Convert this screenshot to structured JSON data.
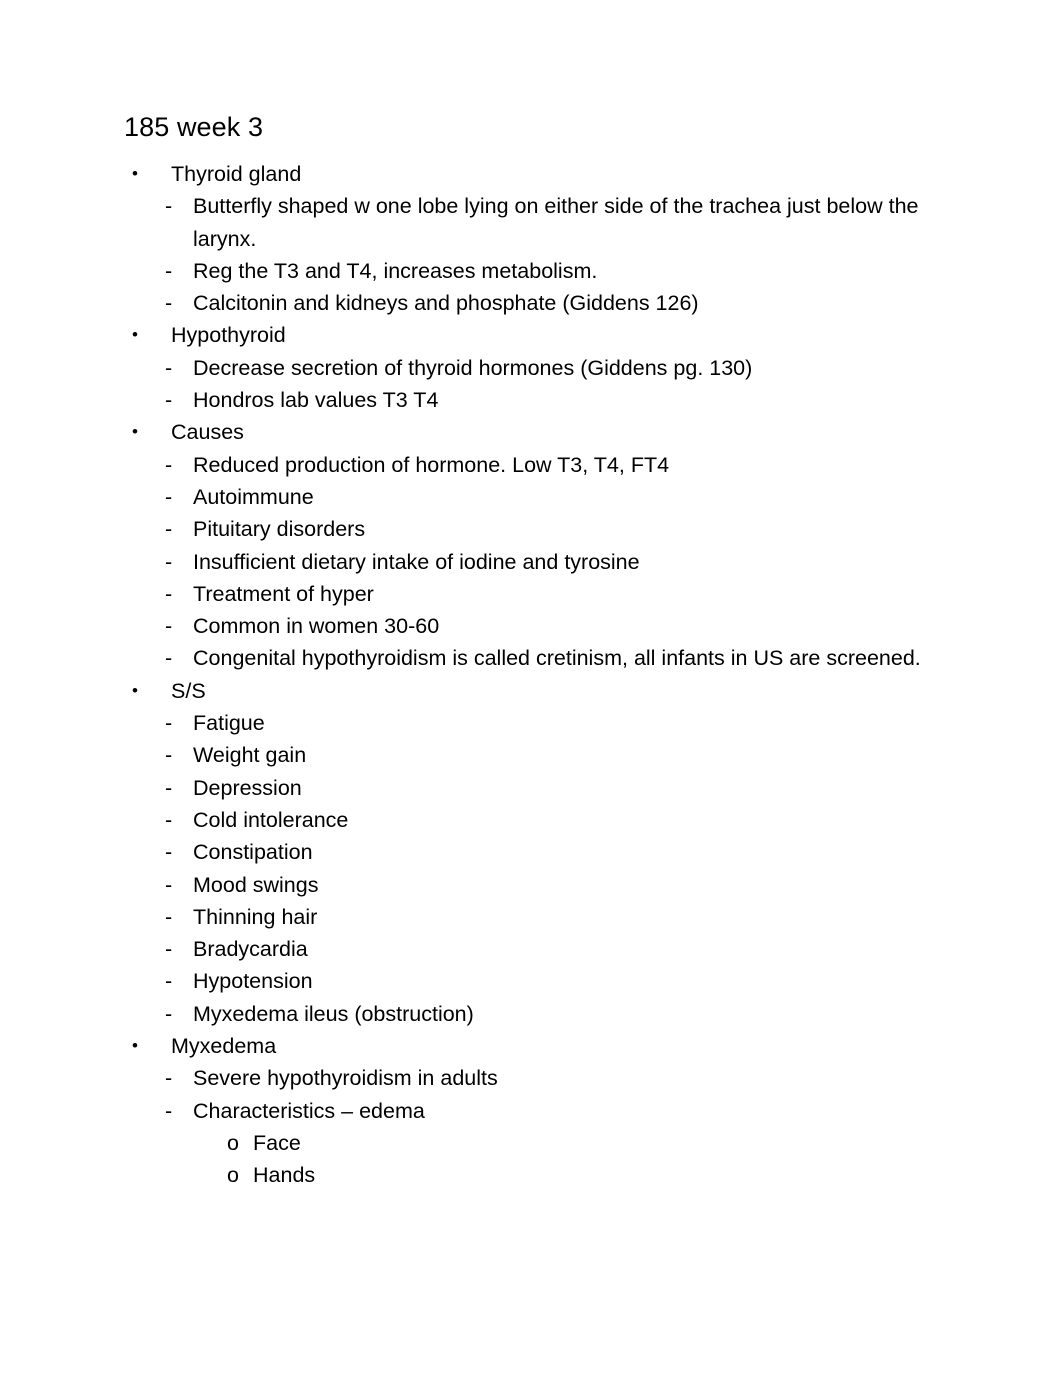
{
  "document": {
    "title": "185 week 3",
    "background_color": "#ffffff",
    "text_color": "#000000",
    "markers": {
      "level1": "•",
      "level2": "-",
      "level3": "o"
    },
    "outline": [
      {
        "level": 1,
        "text": "Thyroid gland"
      },
      {
        "level": 2,
        "text": "Butterfly shaped w one lobe lying on either side of the trachea just below the larynx."
      },
      {
        "level": 2,
        "text": "Reg the T3 and T4, increases metabolism."
      },
      {
        "level": 2,
        "text": "Calcitonin and kidneys and phosphate (Giddens 126)"
      },
      {
        "level": 1,
        "text": "Hypothyroid"
      },
      {
        "level": 2,
        "text": "Decrease secretion of thyroid hormones (Giddens pg. 130)"
      },
      {
        "level": 2,
        "text": "Hondros lab values T3 T4"
      },
      {
        "level": 1,
        "text": "Causes"
      },
      {
        "level": 2,
        "text": "Reduced production of hormone. Low T3, T4, FT4"
      },
      {
        "level": 2,
        "text": "Autoimmune"
      },
      {
        "level": 2,
        "text": "Pituitary disorders"
      },
      {
        "level": 2,
        "text": "Insufficient dietary intake of iodine and tyrosine"
      },
      {
        "level": 2,
        "text": "Treatment of hyper"
      },
      {
        "level": 2,
        "text": "Common in women 30-60"
      },
      {
        "level": 2,
        "text": "Congenital hypothyroidism is called cretinism, all infants in US are screened."
      },
      {
        "level": 1,
        "text": "S/S"
      },
      {
        "level": 2,
        "text": "Fatigue"
      },
      {
        "level": 2,
        "text": "Weight gain"
      },
      {
        "level": 2,
        "text": "Depression"
      },
      {
        "level": 2,
        "text": "Cold intolerance"
      },
      {
        "level": 2,
        "text": "Constipation"
      },
      {
        "level": 2,
        "text": "Mood swings"
      },
      {
        "level": 2,
        "text": "Thinning hair"
      },
      {
        "level": 2,
        "text": "Bradycardia"
      },
      {
        "level": 2,
        "text": "Hypotension"
      },
      {
        "level": 2,
        "text": "Myxedema ileus (obstruction)"
      },
      {
        "level": 1,
        "text": "Myxedema"
      },
      {
        "level": 2,
        "text": "Severe hypothyroidism in adults"
      },
      {
        "level": 2,
        "text": "Characteristics – edema"
      },
      {
        "level": 3,
        "text": "Face"
      },
      {
        "level": 3,
        "text": "Hands"
      }
    ]
  }
}
